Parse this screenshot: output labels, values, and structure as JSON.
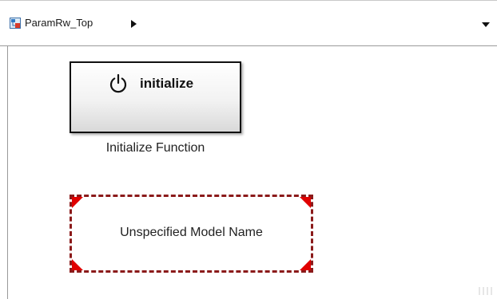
{
  "explorer_bar": {
    "model_name": "ParamRw_Top",
    "model_icon": "simulink-model-icon",
    "nav_arrow_icon": "chevron-right-icon",
    "dropdown_icon": "chevron-down-icon"
  },
  "canvas": {
    "initialize_block": {
      "icon": "power-icon",
      "label": "initialize",
      "caption": "Initialize Function"
    },
    "model_reference_block": {
      "label": "Unspecified Model Name",
      "border_color": "#8b1a1a",
      "corner_color": "#e00000"
    }
  }
}
